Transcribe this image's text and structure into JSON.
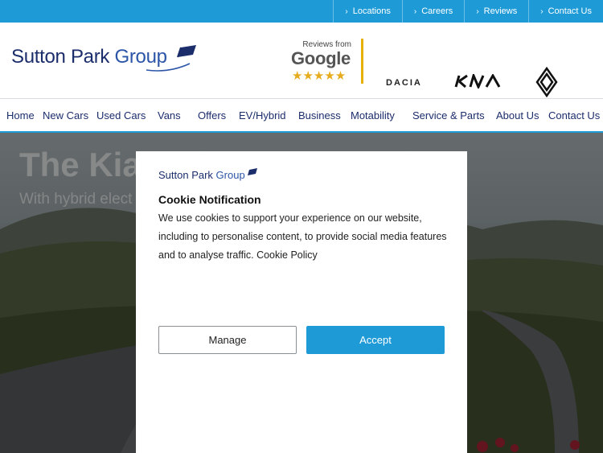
{
  "topbar": {
    "links": [
      {
        "label": "Locations"
      },
      {
        "label": "Careers"
      },
      {
        "label": "Reviews"
      },
      {
        "label": "Contact Us"
      }
    ]
  },
  "header": {
    "logo_word": "Sutton Park ",
    "logo_group": "Group",
    "google": {
      "reviews_from": "Reviews from",
      "word": "Google",
      "stars": "★★★★★"
    },
    "brands": [
      {
        "name": "DACIA"
      },
      {
        "name": "KIA"
      },
      {
        "name": "Renault"
      }
    ]
  },
  "nav": {
    "items": [
      {
        "label": "Home"
      },
      {
        "label": "New Cars"
      },
      {
        "label": "Used Cars"
      },
      {
        "label": "Vans"
      },
      {
        "label": "Offers"
      },
      {
        "label": "EV/Hybrid"
      },
      {
        "label": "Business"
      },
      {
        "label": "Motability"
      },
      {
        "label": "Service & Parts"
      },
      {
        "label": "About Us"
      },
      {
        "label": "Contact Us"
      }
    ]
  },
  "hero": {
    "headline": "The Kia S",
    "sub": "With hybrid elect"
  },
  "cookie": {
    "logo_word": "Sutton Park ",
    "logo_group": "Group",
    "title": "Cookie Notification",
    "body": "We use cookies to support your experience on our website, including to personalise content, to provide social media features and to analyse traffic. Cookie Policy",
    "manage_label": "Manage",
    "accept_label": "Accept"
  },
  "colors": {
    "accent": "#1e9bd7",
    "navy": "#1b2d6b",
    "google_gold": "#e6ac1d"
  }
}
